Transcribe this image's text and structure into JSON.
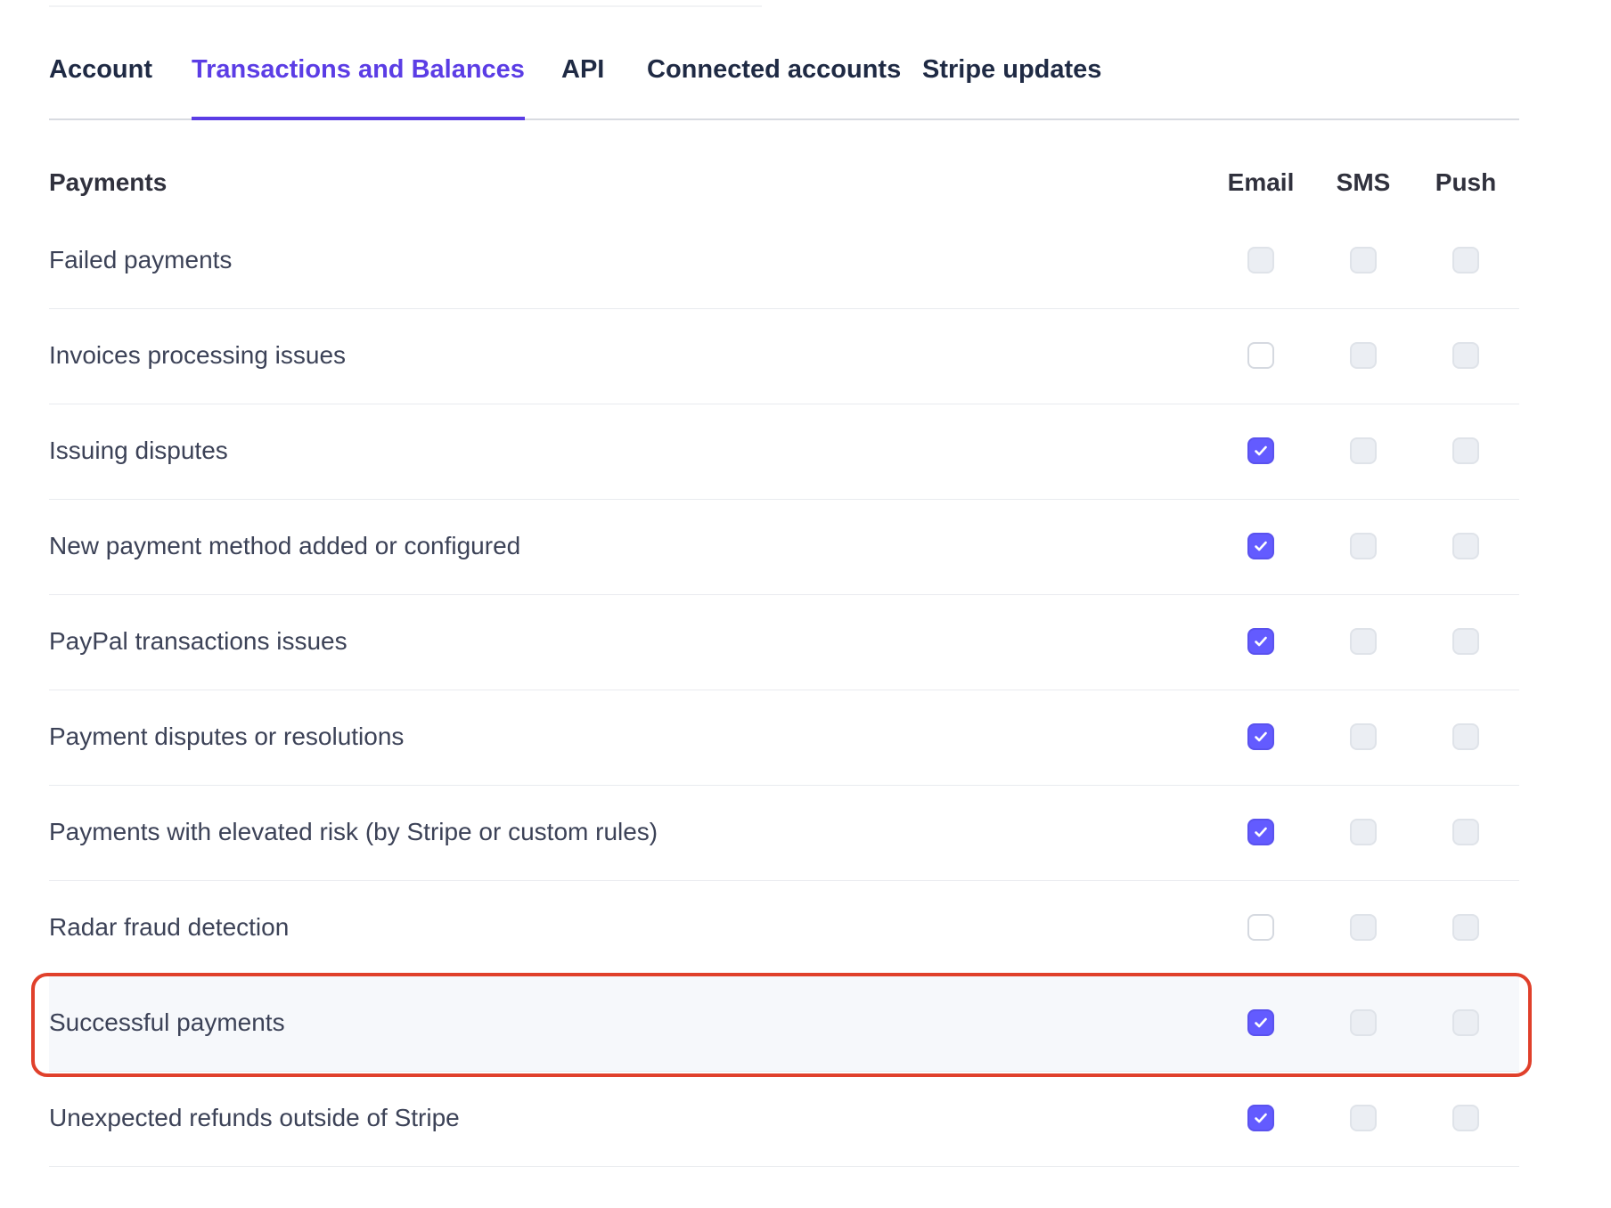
{
  "tabs": [
    {
      "label": "Account",
      "active": false
    },
    {
      "label": "Transactions and Balances",
      "active": true
    },
    {
      "label": "API",
      "active": false
    },
    {
      "label": "Connected accounts",
      "active": false
    },
    {
      "label": "Stripe updates",
      "active": false
    }
  ],
  "section": {
    "title": "Payments",
    "columns": [
      "Email",
      "SMS",
      "Push"
    ]
  },
  "rows": [
    {
      "label": "Failed payments",
      "email": "disabled",
      "sms": "disabled",
      "push": "disabled"
    },
    {
      "label": "Invoices processing issues",
      "email": "unchecked",
      "sms": "disabled",
      "push": "disabled"
    },
    {
      "label": "Issuing disputes",
      "email": "checked",
      "sms": "disabled",
      "push": "disabled"
    },
    {
      "label": "New payment method added or configured",
      "email": "checked",
      "sms": "disabled",
      "push": "disabled"
    },
    {
      "label": "PayPal transactions issues",
      "email": "checked",
      "sms": "disabled",
      "push": "disabled"
    },
    {
      "label": "Payment disputes or resolutions",
      "email": "checked",
      "sms": "disabled",
      "push": "disabled"
    },
    {
      "label": "Payments with elevated risk (by Stripe or custom rules)",
      "email": "checked",
      "sms": "disabled",
      "push": "disabled"
    },
    {
      "label": "Radar fraud detection",
      "email": "unchecked",
      "sms": "disabled",
      "push": "disabled"
    },
    {
      "label": "Successful payments",
      "email": "checked",
      "sms": "disabled",
      "push": "disabled",
      "highlighted": true
    },
    {
      "label": "Unexpected refunds outside of Stripe",
      "email": "checked",
      "sms": "disabled",
      "push": "disabled"
    }
  ],
  "colors": {
    "accent": "#635bff",
    "active_tab": "#5b3de5",
    "highlight_border": "#e0402b",
    "highlight_bg": "#f6f8fb"
  },
  "icons": {
    "checked": "check-icon"
  }
}
